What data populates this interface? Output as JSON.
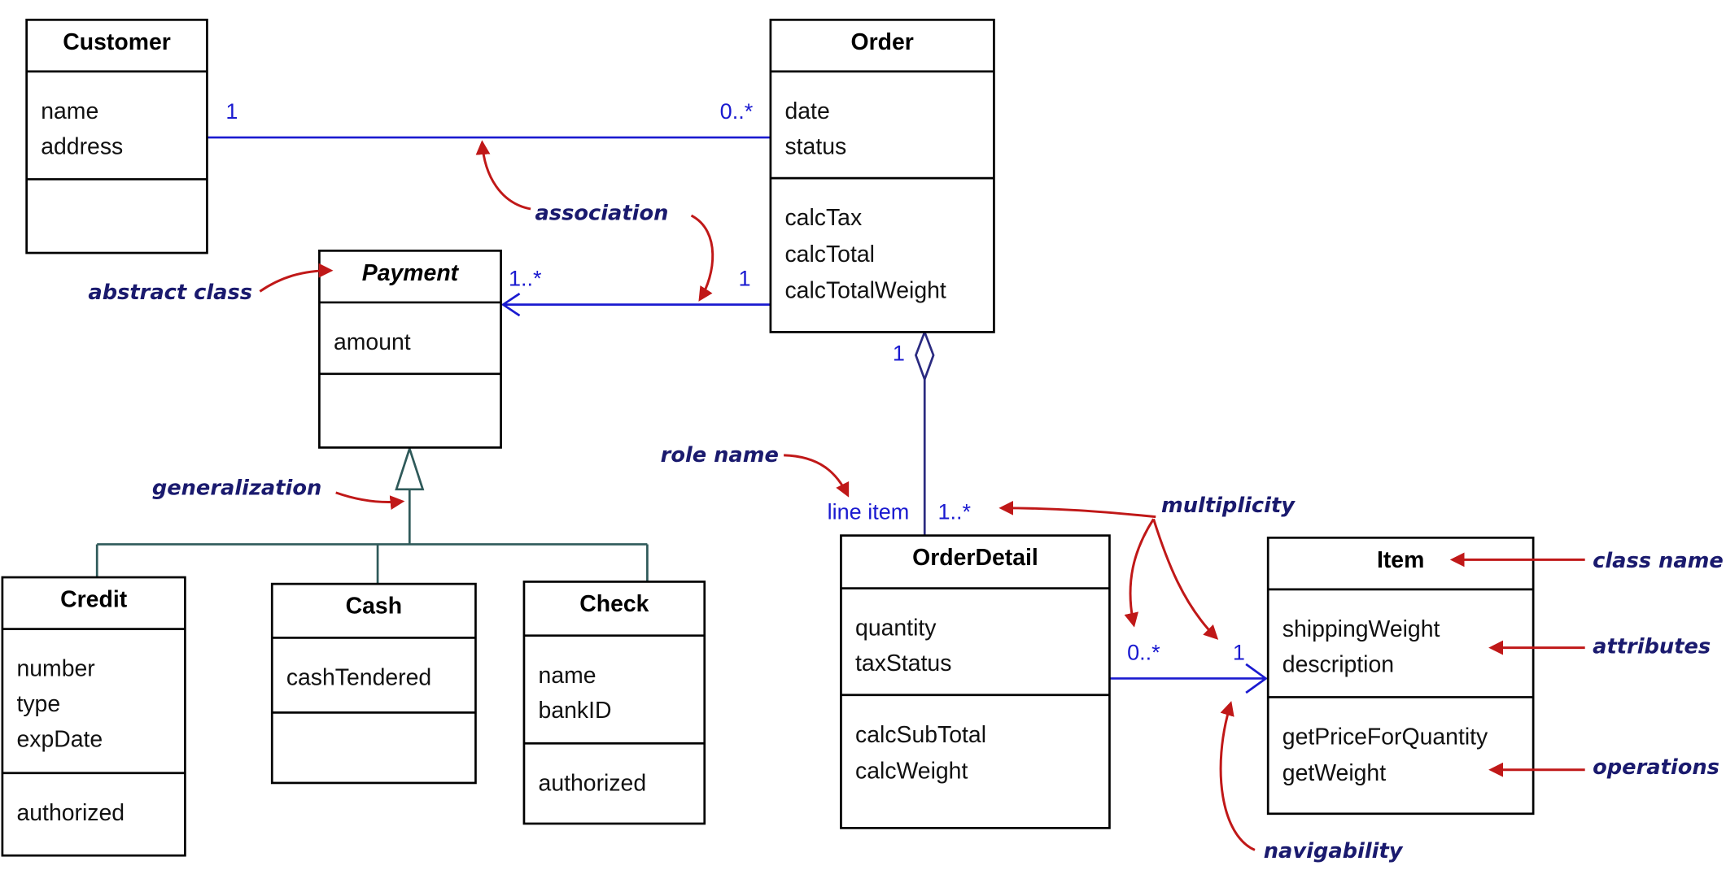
{
  "colors": {
    "box": "#000000",
    "association": "#1a1ad0",
    "aggregation": "#2a2a80",
    "generalization": "#2f5a5a",
    "annotation_text": "#1a1a6e",
    "annotation_arrow": "#c01818"
  },
  "classes": [
    {
      "id": "customer",
      "name": "Customer",
      "abstract": false,
      "attributes": [
        "name",
        "address"
      ],
      "operations": []
    },
    {
      "id": "order",
      "name": "Order",
      "abstract": false,
      "attributes": [
        "date",
        "status"
      ],
      "operations": [
        "calcTax",
        "calcTotal",
        "calcTotalWeight"
      ]
    },
    {
      "id": "payment",
      "name": "Payment",
      "abstract": true,
      "attributes": [
        "amount"
      ],
      "operations": []
    },
    {
      "id": "credit",
      "name": "Credit",
      "abstract": false,
      "attributes": [
        "number",
        "type",
        "expDate"
      ],
      "operations": [
        "authorized"
      ]
    },
    {
      "id": "cash",
      "name": "Cash",
      "abstract": false,
      "attributes": [
        "cashTendered"
      ],
      "operations": []
    },
    {
      "id": "check",
      "name": "Check",
      "abstract": false,
      "attributes": [
        "name",
        "bankID"
      ],
      "operations": [
        "authorized"
      ]
    },
    {
      "id": "orderdetail",
      "name": "OrderDetail",
      "abstract": false,
      "attributes": [
        "quantity",
        "taxStatus"
      ],
      "operations": [
        "calcSubTotal",
        "calcWeight"
      ]
    },
    {
      "id": "item",
      "name": "Item",
      "abstract": false,
      "attributes": [
        "shippingWeight",
        "description"
      ],
      "operations": [
        "getPriceForQuantity",
        "getWeight"
      ]
    }
  ],
  "relationships": [
    {
      "type": "association",
      "from": "customer",
      "to": "order",
      "from_mult": "1",
      "to_mult": "0..*"
    },
    {
      "type": "directed-association",
      "from": "order",
      "to": "payment",
      "from_mult": "1",
      "to_mult": "1..*"
    },
    {
      "type": "aggregation",
      "whole": "order",
      "part": "orderdetail",
      "whole_mult": "1",
      "part_mult": "1..*",
      "role": "line item"
    },
    {
      "type": "generalization",
      "parent": "payment",
      "children": [
        "credit",
        "cash",
        "check"
      ]
    },
    {
      "type": "directed-association",
      "from": "orderdetail",
      "to": "item",
      "from_mult": "0..*",
      "to_mult": "1"
    }
  ],
  "annotations": {
    "association": "association",
    "abstract_class": "abstract class",
    "generalization": "generalization",
    "role_name": "role name",
    "multiplicity": "multiplicity",
    "class_name": "class name",
    "attributes": "attributes",
    "operations": "operations",
    "navigability": "navigability"
  }
}
